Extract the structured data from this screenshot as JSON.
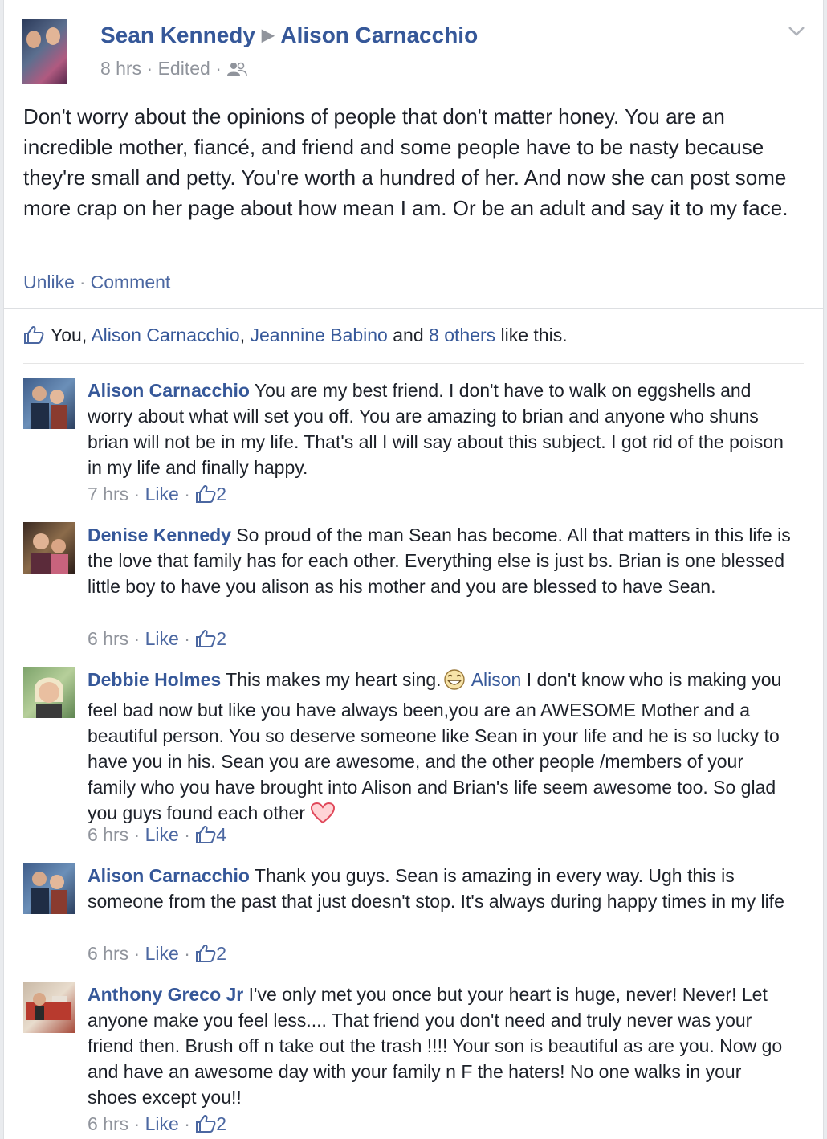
{
  "post": {
    "author": "Sean Kennedy",
    "target": "Alison Carnacchio",
    "time": "8 hrs",
    "edited": "Edited",
    "body": "Don't worry about the opinions of people that don't matter honey. You are an incredible mother, fiancé, and friend and some people have to be nasty because they're small and petty. You're worth a hundred of her. And now she can post some more crap on her page about how mean I am. Or be an adult and say it to my face.",
    "unlike_label": "Unlike",
    "comment_label": "Comment"
  },
  "likes": {
    "you": "You,",
    "person1": "Alison Carnacchio",
    "comma": ",",
    "person2": "Jeannine Babino",
    "and": "and",
    "others": "8 others",
    "suffix": "like this."
  },
  "comments": [
    {
      "name": "Alison Carnacchio",
      "text": "You are my best friend. I don't have to walk on eggshells and worry about what will set you off. You are amazing to brian and anyone who shuns brian will not be in my life. That's all I will say about this subject. I got rid of the poison in my life and finally happy.",
      "time": "7 hrs",
      "like_label": "Like",
      "like_count": "2"
    },
    {
      "name": "Denise Kennedy",
      "text": "So proud of the man Sean has become. All that matters in this life is the love that family has for each other. Everything else is just bs. Brian is one blessed little boy to have you alison as his mother and you are blessed to have Sean.",
      "time": "6 hrs",
      "like_label": "Like",
      "like_count": "2"
    },
    {
      "name": "Debbie Holmes",
      "text_a": "This makes my heart sing.",
      "mention": "Alison",
      "text_b": "I don't know who is making you feel bad now but like you have always been,you are an AWESOME Mother and a beautiful person. You so deserve someone like Sean in your life and he is so lucky to have you in his. Sean you are awesome, and the other people /members of your family who you have brought into Alison and Brian's life seem awesome too. So glad you guys found each other",
      "time": "6 hrs",
      "like_label": "Like",
      "like_count": "4"
    },
    {
      "name": "Alison Carnacchio",
      "text": "Thank you guys. Sean is amazing in every way. Ugh this is someone from the past that just doesn't stop. It's always during happy times in my life",
      "time": "6 hrs",
      "like_label": "Like",
      "like_count": "2"
    },
    {
      "name": "Anthony Greco Jr",
      "text": "I've only met you once but your heart is huge, never! Never! Let anyone make you feel less.... That friend you don't need and truly never was your friend then. Brush off n take out the trash !!!! Your son is beautiful as are you. Now go and have an awesome day with your family n F the haters! No one walks in your shoes except you!!",
      "time": "6 hrs",
      "like_label": "Like",
      "like_count": "2"
    }
  ],
  "separator": "·",
  "colors": {
    "link": "#365899",
    "meta": "#90949c",
    "background": "#e9ebee"
  }
}
